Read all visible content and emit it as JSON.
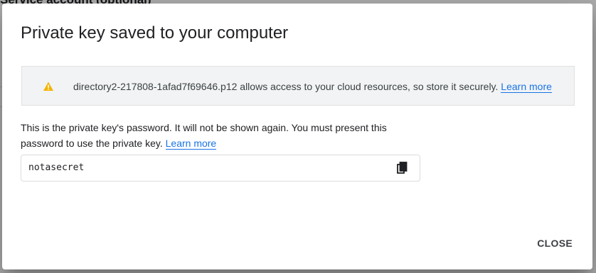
{
  "background": {
    "partial_heading": "Service account (optional)"
  },
  "dialog": {
    "title": "Private key saved to your computer",
    "warning": {
      "icon": "warning-icon",
      "icon_color": "#f4b400",
      "message": "directory2-217808-1afad7f69646.p12 allows access to your cloud resources, so store it securely.",
      "learn_more": "Learn more"
    },
    "password_note": {
      "text": "This is the private key's password. It will not be shown again. You must present this password to use the private key.",
      "learn_more": "Learn more"
    },
    "password_field": {
      "value": "notasecret",
      "copy_icon": "copy-icon"
    },
    "close_label": "CLOSE"
  },
  "colors": {
    "link": "#1a73e8",
    "banner_background": "#f1f3f4"
  }
}
